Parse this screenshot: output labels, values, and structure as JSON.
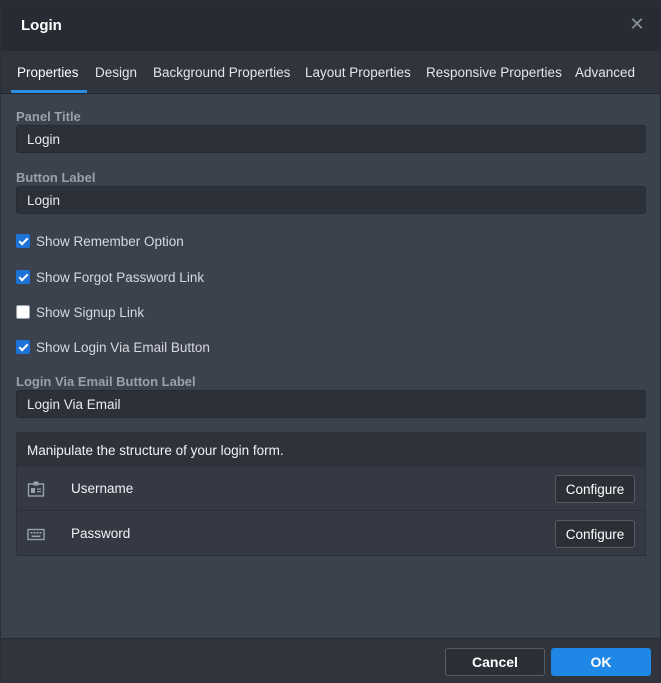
{
  "dialog": {
    "title": "Login"
  },
  "tabs": [
    {
      "label": "Properties",
      "active": true
    },
    {
      "label": "Design"
    },
    {
      "label": "Background Properties"
    },
    {
      "label": "Layout Properties"
    },
    {
      "label": "Responsive Properties"
    },
    {
      "label": "Advanced"
    }
  ],
  "fields": {
    "panel_title": {
      "label": "Panel Title",
      "value": "Login"
    },
    "button_label": {
      "label": "Button Label",
      "value": "Login"
    },
    "email_button_label": {
      "label": "Login Via Email Button Label",
      "value": "Login Via Email"
    }
  },
  "checkboxes": [
    {
      "label": "Show Remember Option",
      "checked": true
    },
    {
      "label": "Show Forgot Password Link",
      "checked": true
    },
    {
      "label": "Show Signup Link",
      "checked": false
    },
    {
      "label": "Show Login Via Email Button",
      "checked": true
    }
  ],
  "structure": {
    "heading": "Manipulate the structure of your login form.",
    "rows": [
      {
        "name": "Username",
        "icon": "id-card-icon",
        "button": "Configure"
      },
      {
        "name": "Password",
        "icon": "keyboard-icon",
        "button": "Configure"
      }
    ]
  },
  "footer": {
    "cancel_label": "Cancel",
    "ok_label": "OK"
  },
  "colors": {
    "accent": "#1f87e5",
    "checkbox": "#1d73d8",
    "background": "#3b414d"
  }
}
